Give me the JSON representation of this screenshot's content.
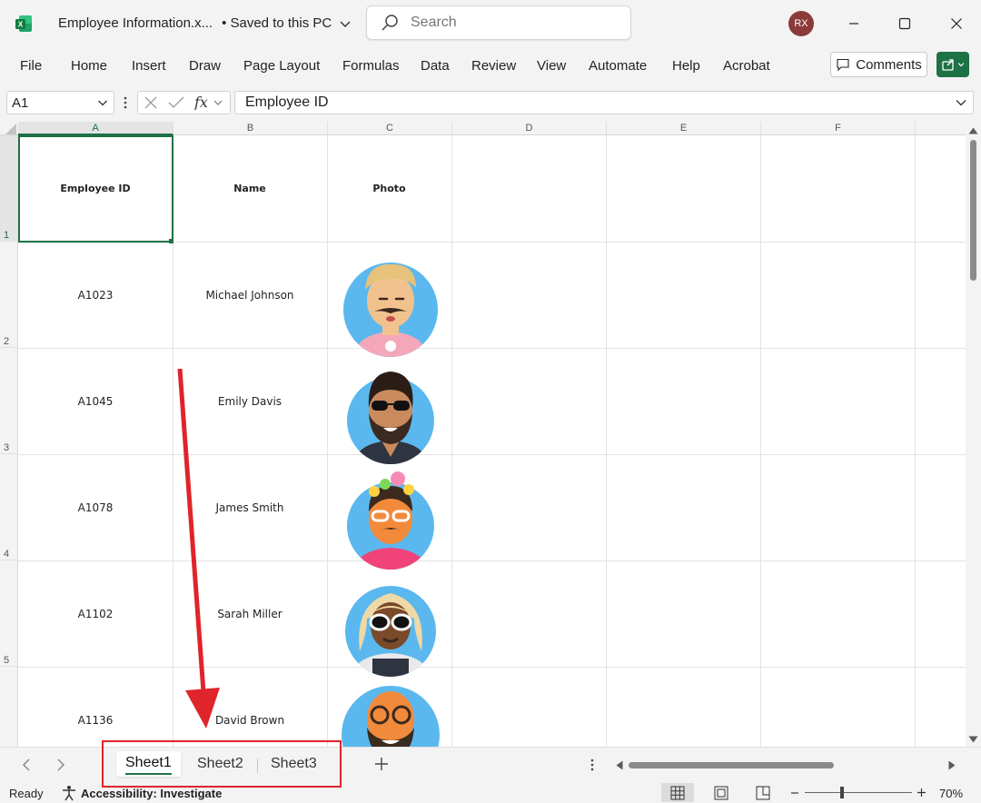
{
  "titlebar": {
    "doc_title": "Employee Information.x...",
    "save_status": "• Saved to this PC",
    "search_placeholder": "Search",
    "avatar_initials": "RX"
  },
  "ribbon": {
    "tabs": [
      "File",
      "Home",
      "Insert",
      "Draw",
      "Page Layout",
      "Formulas",
      "Data",
      "Review",
      "View",
      "Automate",
      "Help",
      "Acrobat"
    ],
    "comments_label": "Comments"
  },
  "formula_bar": {
    "name_box": "A1",
    "formula": "Employee ID"
  },
  "grid": {
    "columns": [
      "A",
      "B",
      "C",
      "D",
      "E",
      "F"
    ],
    "rows": [
      "1",
      "2",
      "3",
      "4",
      "5"
    ],
    "headers": [
      "Employee ID",
      "Name",
      "Photo"
    ],
    "records": [
      {
        "id": "A1023",
        "name": "Michael Johnson",
        "photo": "avatar-blond-mustache"
      },
      {
        "id": "A1045",
        "name": "Emily Davis",
        "photo": "avatar-bearded-sunglasses"
      },
      {
        "id": "A1078",
        "name": "James Smith",
        "photo": "avatar-flower-crown"
      },
      {
        "id": "A1102",
        "name": "Sarah Miller",
        "photo": "avatar-white-sunglasses"
      },
      {
        "id": "A1136",
        "name": "David Brown",
        "photo": "avatar-laughing-glasses"
      }
    ]
  },
  "sheets": {
    "tabs": [
      "Sheet1",
      "Sheet2",
      "Sheet3"
    ],
    "active": "Sheet1"
  },
  "status": {
    "ready": "Ready",
    "accessibility": "Accessibility: Investigate",
    "zoom": "70%"
  },
  "colors": {
    "excel_green": "#1e7145",
    "annotation_red": "#e0242b"
  }
}
